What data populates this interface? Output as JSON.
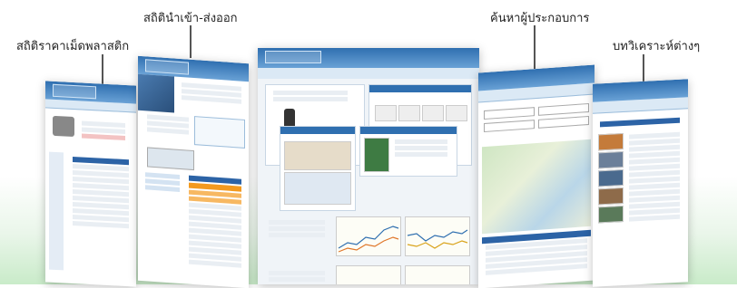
{
  "labels": {
    "plastic_price_stats": "สถิติราคาเม็ดพลาสติก",
    "import_export_stats": "สถิตินำเข้า-ส่งออก",
    "search_operators": "ค้นหาผู้ประกอบการ",
    "analysis_articles": "บทวิเคราะห์ต่างๆ"
  },
  "colors": {
    "header_blue": "#2f6fb0",
    "table_header_orange": "#f39a1f",
    "footer_green": "#c9ebc9"
  }
}
